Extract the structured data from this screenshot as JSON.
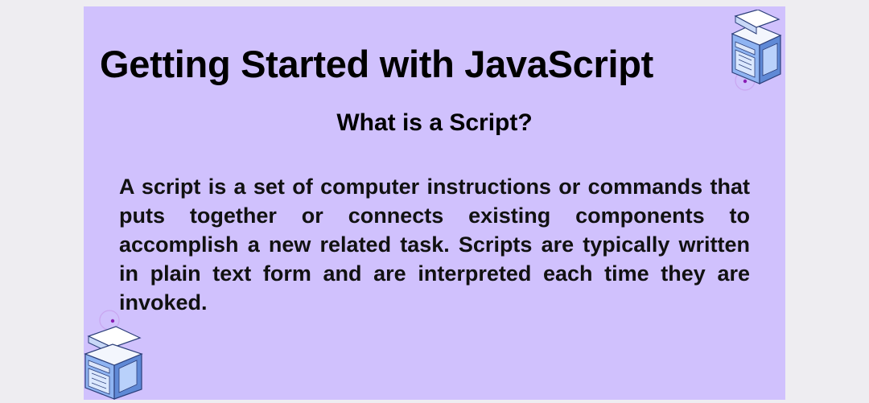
{
  "slide": {
    "title": "Getting Started with JavaScript",
    "subtitle": "What is a Script?",
    "body": "A script is a set of computer instructions or commands that puts together or connects existing components to accomplish a new related task. Scripts are typically written in plain text form and are interpreted each time they are invoked."
  },
  "colors": {
    "slide_background": "#d0c1fd",
    "page_background": "#eeedf1",
    "text": "#000000"
  },
  "icons": [
    "computer-illustration-icon",
    "computer-illustration-icon"
  ]
}
